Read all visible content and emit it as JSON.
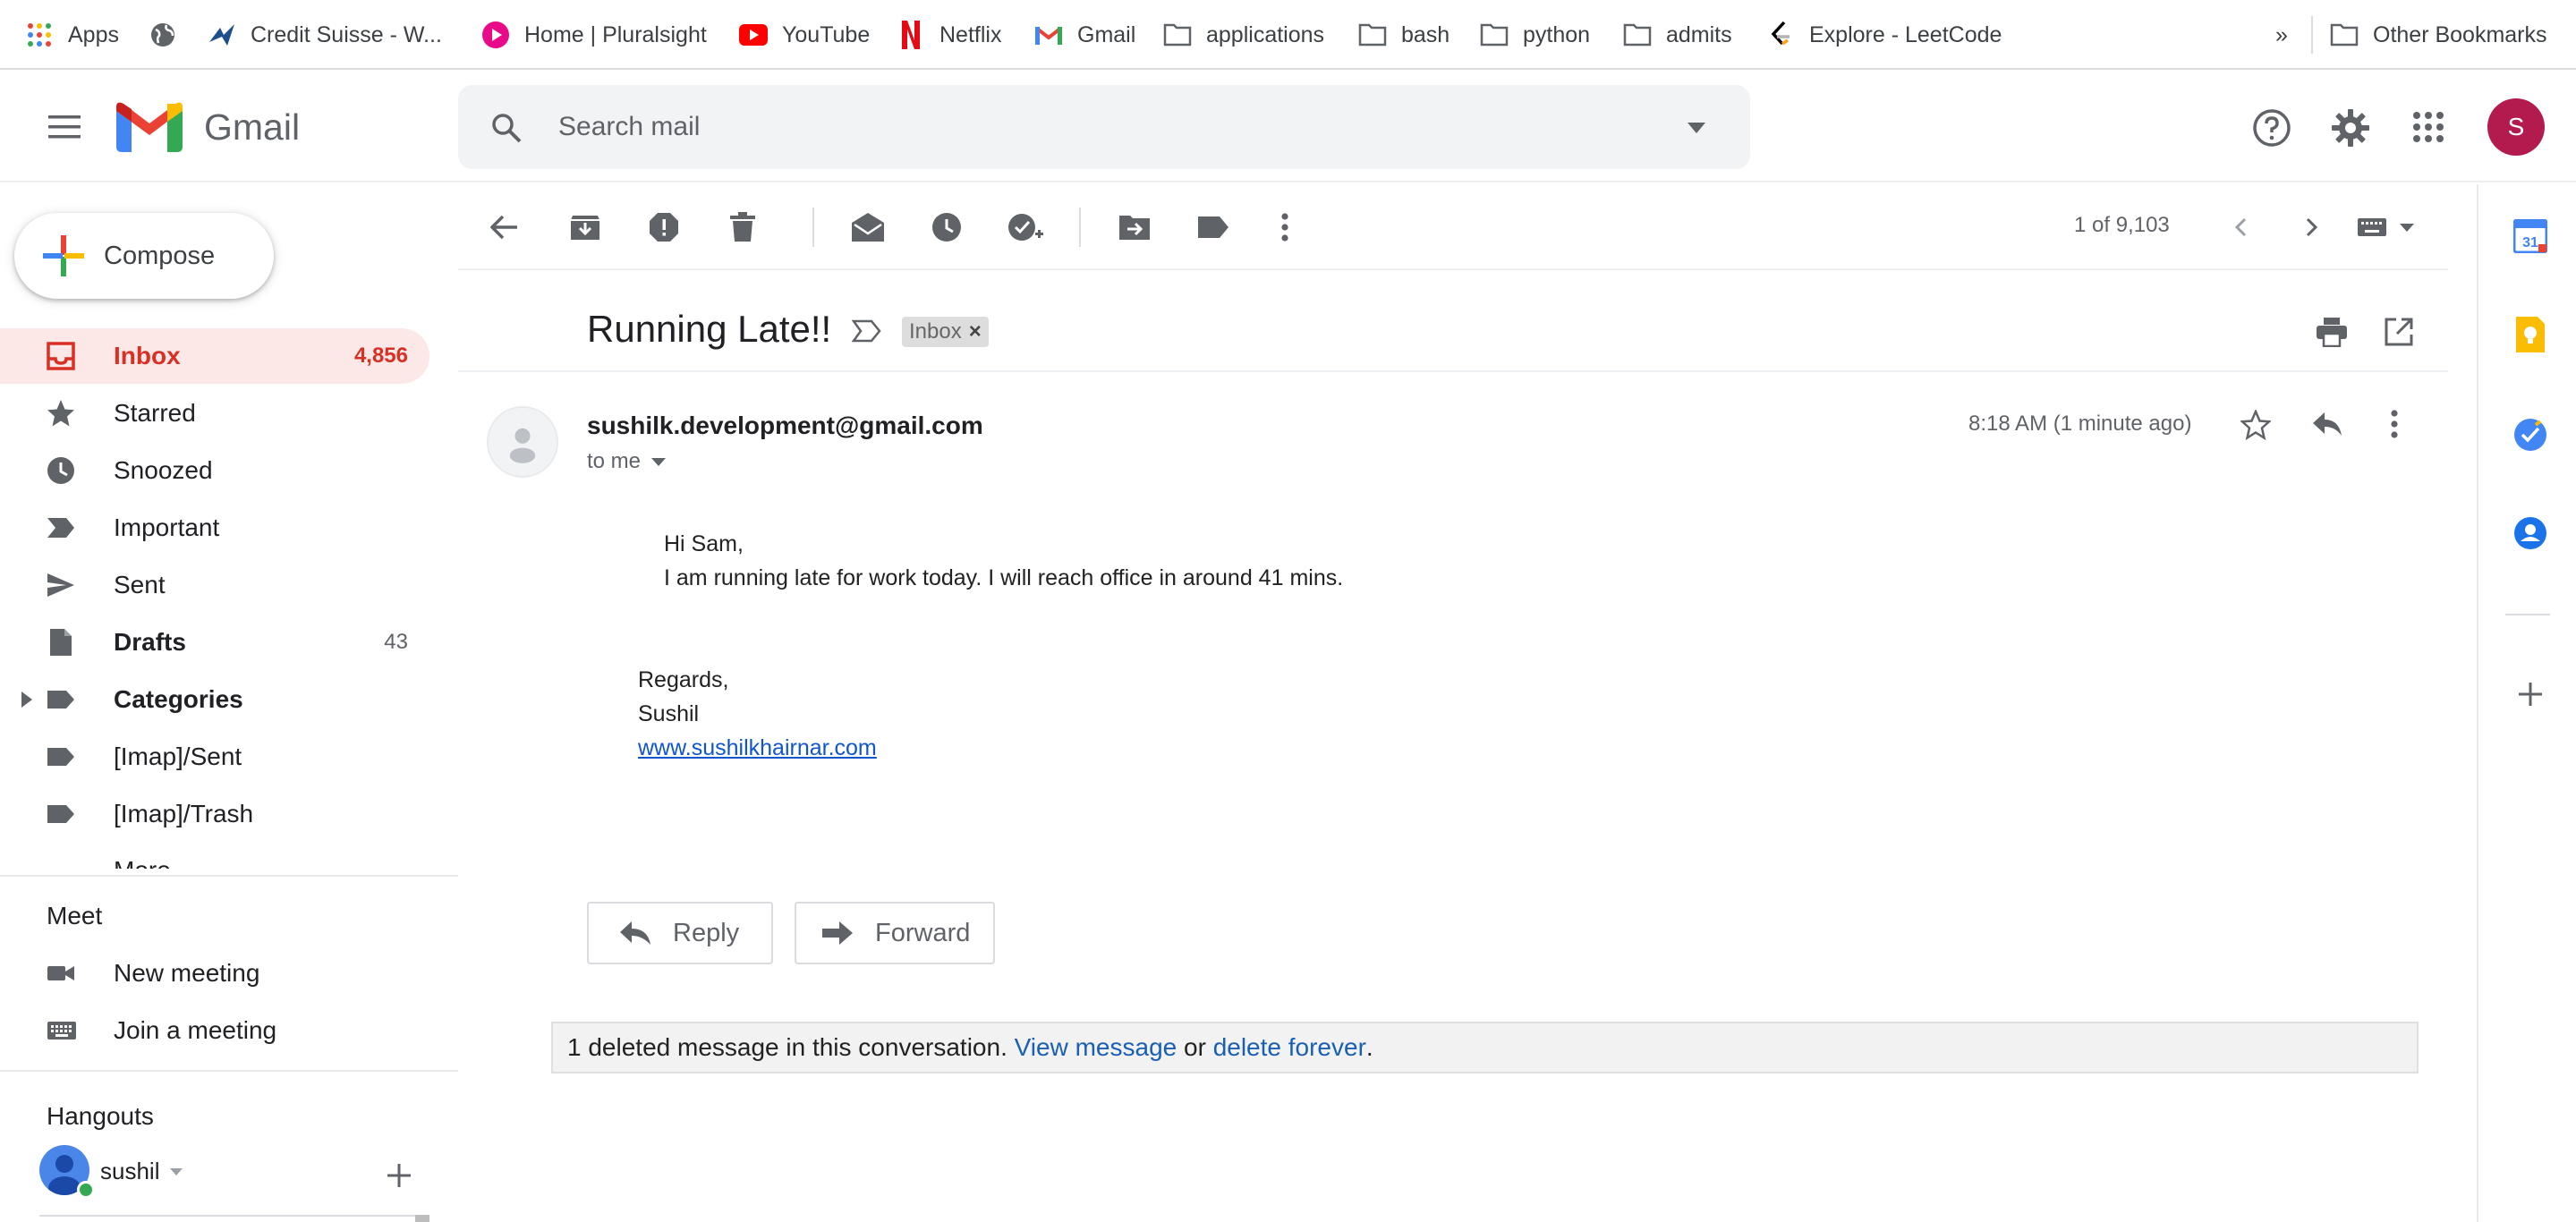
{
  "bookmarks": {
    "items": [
      {
        "label": "Apps",
        "icon": "apps-grid-icon"
      },
      {
        "label": "",
        "icon": "globe-icon"
      },
      {
        "label": "Credit Suisse - W...",
        "icon": "credit-suisse-icon"
      },
      {
        "label": "Home | Pluralsight",
        "icon": "pluralsight-icon"
      },
      {
        "label": "YouTube",
        "icon": "youtube-icon"
      },
      {
        "label": "Netflix",
        "icon": "netflix-icon"
      },
      {
        "label": "Gmail",
        "icon": "gmail-icon"
      },
      {
        "label": "applications",
        "icon": "folder-icon"
      },
      {
        "label": "bash",
        "icon": "folder-icon"
      },
      {
        "label": "python",
        "icon": "folder-icon"
      },
      {
        "label": "admits",
        "icon": "folder-icon"
      },
      {
        "label": "Explore - LeetCode",
        "icon": "leetcode-icon"
      }
    ],
    "overflow": "»",
    "other": "Other Bookmarks"
  },
  "header": {
    "app_name": "Gmail",
    "search_placeholder": "Search mail",
    "account_initial": "S"
  },
  "sidebar": {
    "compose_label": "Compose",
    "items": [
      {
        "label": "Inbox",
        "count": "4,856",
        "icon": "inbox-icon"
      },
      {
        "label": "Starred",
        "count": "",
        "icon": "star-icon"
      },
      {
        "label": "Snoozed",
        "count": "",
        "icon": "clock-icon"
      },
      {
        "label": "Important",
        "count": "",
        "icon": "important-icon"
      },
      {
        "label": "Sent",
        "count": "",
        "icon": "send-icon"
      },
      {
        "label": "Drafts",
        "count": "43",
        "icon": "draft-icon"
      },
      {
        "label": "Categories",
        "count": "",
        "icon": "label-icon"
      },
      {
        "label": "[Imap]/Sent",
        "count": "",
        "icon": "label-icon"
      },
      {
        "label": "[Imap]/Trash",
        "count": "",
        "icon": "label-icon"
      },
      {
        "label": "More",
        "count": "",
        "icon": "chevron-down-icon"
      }
    ],
    "meet": {
      "title": "Meet",
      "new_meeting": "New meeting",
      "join_meeting": "Join a meeting"
    },
    "hangouts": {
      "title": "Hangouts",
      "user": "sushil"
    }
  },
  "toolbar": {
    "pager": "1 of 9,103"
  },
  "message": {
    "subject": "Inbox",
    "subject_title": "Running Late!!",
    "label_chip": "Inbox",
    "label_chip_close": "×",
    "sender": "sushilk.development@gmail.com",
    "to": "to me",
    "time": "8:18 AM (1 minute ago)",
    "body": {
      "greeting": "Hi Sam,",
      "line1": "I am running late for work today. I will reach office in around 41 mins.",
      "regards": "Regards,",
      "name": "Sushil",
      "link": "www.sushilkhairnar.com"
    },
    "reply_label": "Reply",
    "forward_label": "Forward"
  },
  "deleted_notice": {
    "text": "1 deleted message in this conversation.",
    "view_link": "View message",
    "or": "or",
    "delete_link": "delete forever",
    "period": "."
  },
  "colors": {
    "gmail_red": "#d93025",
    "active_bg": "#fce8e6",
    "avatar_bg": "#b31b4f",
    "link_blue": "#1155cc"
  }
}
